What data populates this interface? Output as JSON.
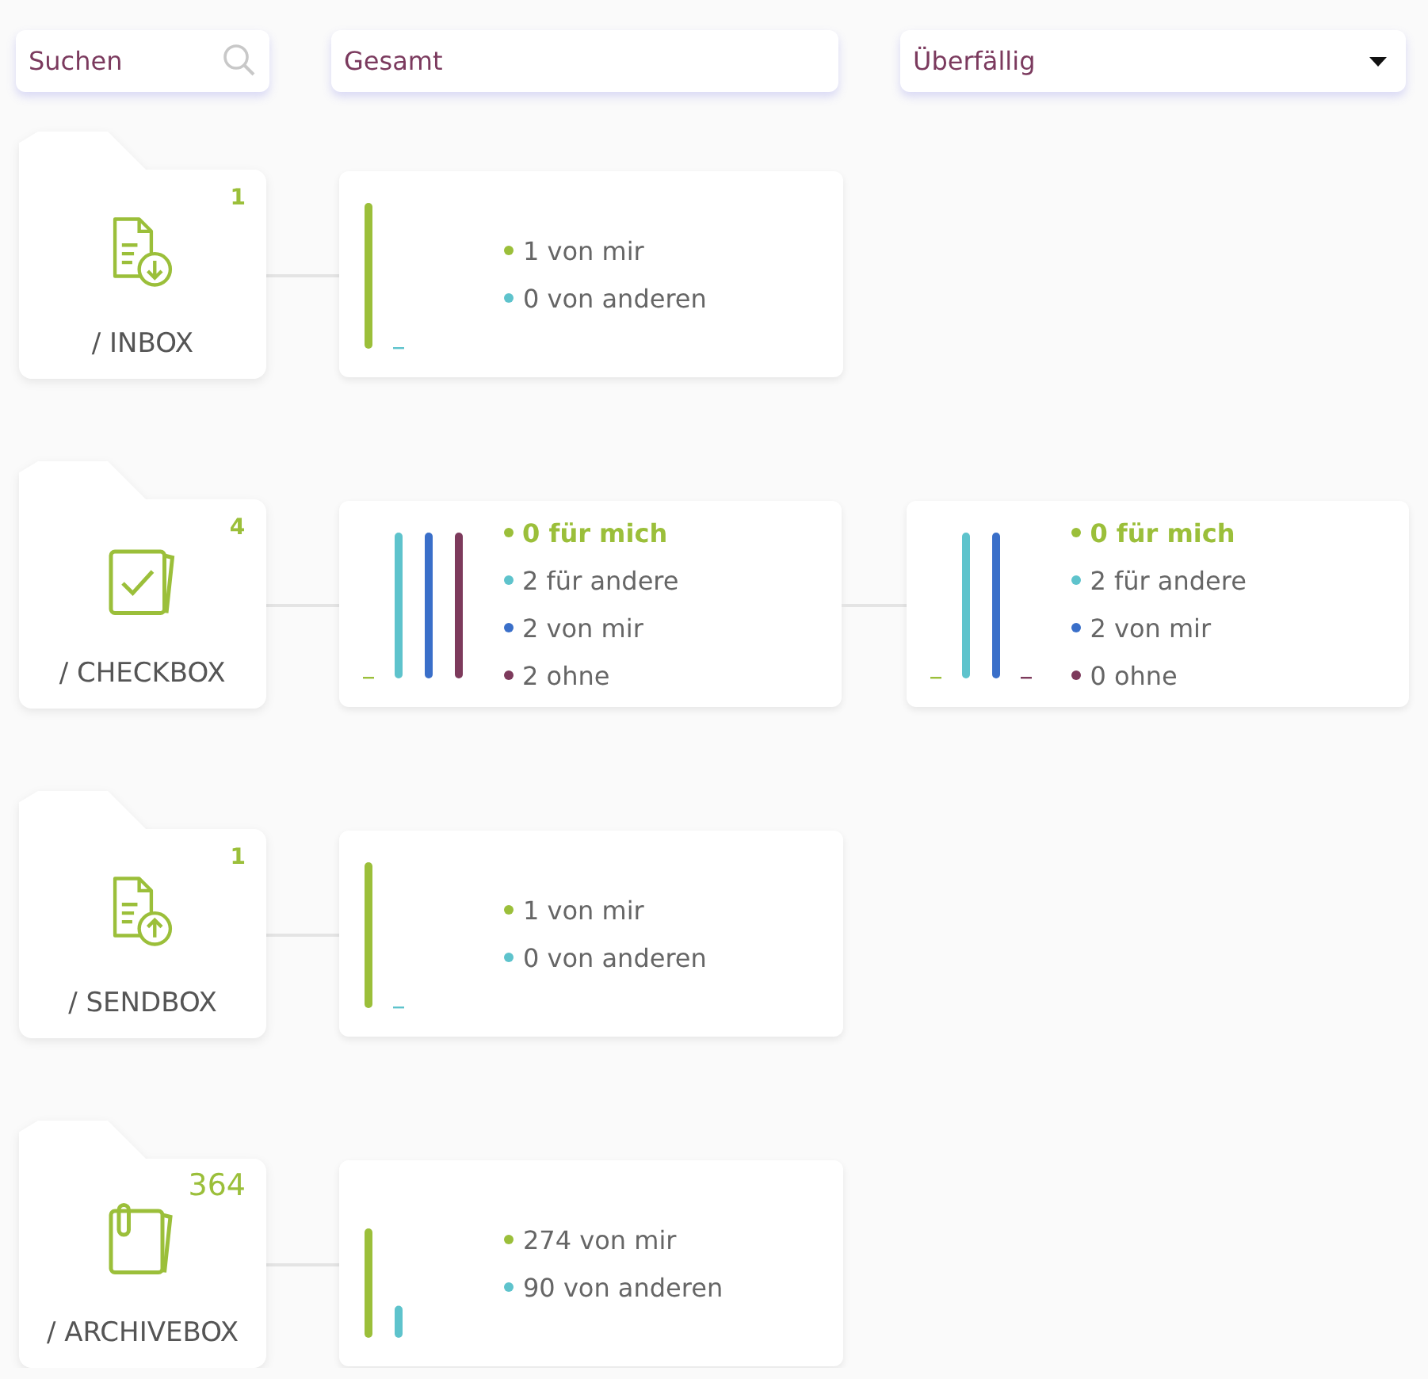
{
  "toolbar": {
    "search": {
      "placeholder": "Suchen"
    },
    "total_field": {
      "value": "Gesamt"
    },
    "filter_dropdown": {
      "value": "Überfällig"
    }
  },
  "folders": [
    {
      "kind": "incoming",
      "name": "/ INBOX",
      "count": "1",
      "cards": [
        {
          "items": [
            {
              "text": "1 von mir",
              "color": "#9bbf3a",
              "highlighted": false
            },
            {
              "text": "0 von anderen",
              "color": "#5ec3cc",
              "highlighted": false
            }
          ]
        }
      ]
    },
    {
      "kind": "tasks",
      "name": "/ CHECKBOX",
      "count": "4",
      "cards": [
        {
          "items": [
            {
              "text": "0 für mich",
              "color": "#9bbf3a",
              "highlighted": true
            },
            {
              "text": "2 für andere",
              "color": "#5ec3cc",
              "highlighted": false
            },
            {
              "text": "2 von mir",
              "color": "#3a6fc9",
              "highlighted": false
            },
            {
              "text": "2 ohne",
              "color": "#7d3a5c",
              "highlighted": false
            }
          ]
        },
        {
          "items": [
            {
              "text": "0 für mich",
              "color": "#9bbf3a",
              "highlighted": true
            },
            {
              "text": "2 für andere",
              "color": "#5ec3cc",
              "highlighted": false
            },
            {
              "text": "2 von mir",
              "color": "#3a6fc9",
              "highlighted": false
            },
            {
              "text": "0 ohne",
              "color": "#7d3a5c",
              "highlighted": false
            }
          ]
        }
      ]
    },
    {
      "kind": "outgoing",
      "name": "/ SENDBOX",
      "count": "1",
      "cards": [
        {
          "items": [
            {
              "text": "1 von mir",
              "color": "#9bbf3a",
              "highlighted": false
            },
            {
              "text": "0 von anderen",
              "color": "#5ec3cc",
              "highlighted": false
            }
          ]
        }
      ]
    },
    {
      "kind": "archive",
      "name": "/ ARCHIVEBOX",
      "count": "364",
      "cards": [
        {
          "items": [
            {
              "text": "274 von mir",
              "color": "#9bbf3a",
              "highlighted": false
            },
            {
              "text": "90 von anderen",
              "color": "#5ec3cc",
              "highlighted": false
            }
          ]
        }
      ]
    }
  ]
}
